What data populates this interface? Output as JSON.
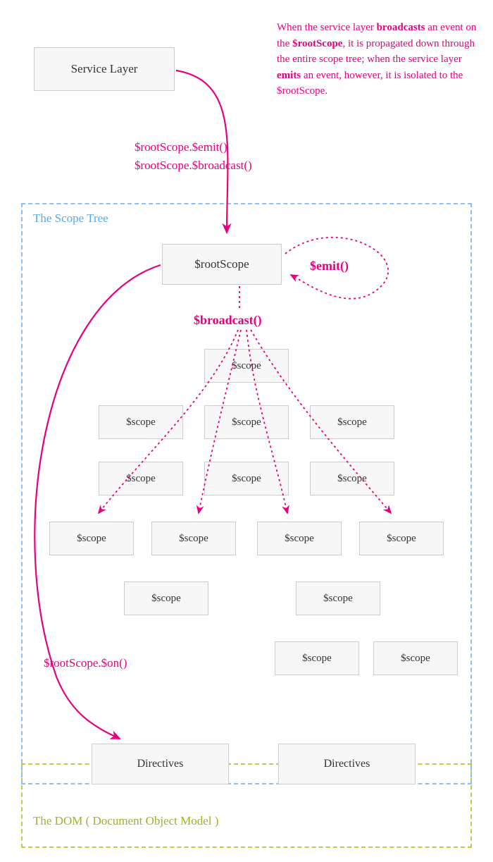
{
  "serviceLayer": {
    "label": "Service Layer"
  },
  "calls": {
    "emit": "$rootScope.$emit()",
    "broadcast": "$rootScope.$broadcast()"
  },
  "scopeTree": {
    "title": "The Scope Tree",
    "rootScope": "$rootScope",
    "emitLabel": "$emit()",
    "broadcastLabel": "$broadcast()",
    "scopeLabel": "$scope"
  },
  "directives": {
    "onCall": "$rootScope.$on()",
    "label": "Directives"
  },
  "dom": {
    "title": "The DOM ( Document Object Model )"
  },
  "description": {
    "p1a": "When the service layer ",
    "p1bold1": "broadcasts",
    "p1b": " an event on the ",
    "p1bold2": "$rootScope",
    "p1c": ", it is propagated down through the entire scope tree; when the service layer ",
    "p1bold3": "emits",
    "p1d": " an event, however, it is isolated to the $rootScope."
  },
  "colors": {
    "magenta": "#e6007e",
    "blue": "#5aa9e6",
    "green": "#9db030",
    "boxBg": "#f7f7f7",
    "boxBorder": "#cccccc"
  }
}
